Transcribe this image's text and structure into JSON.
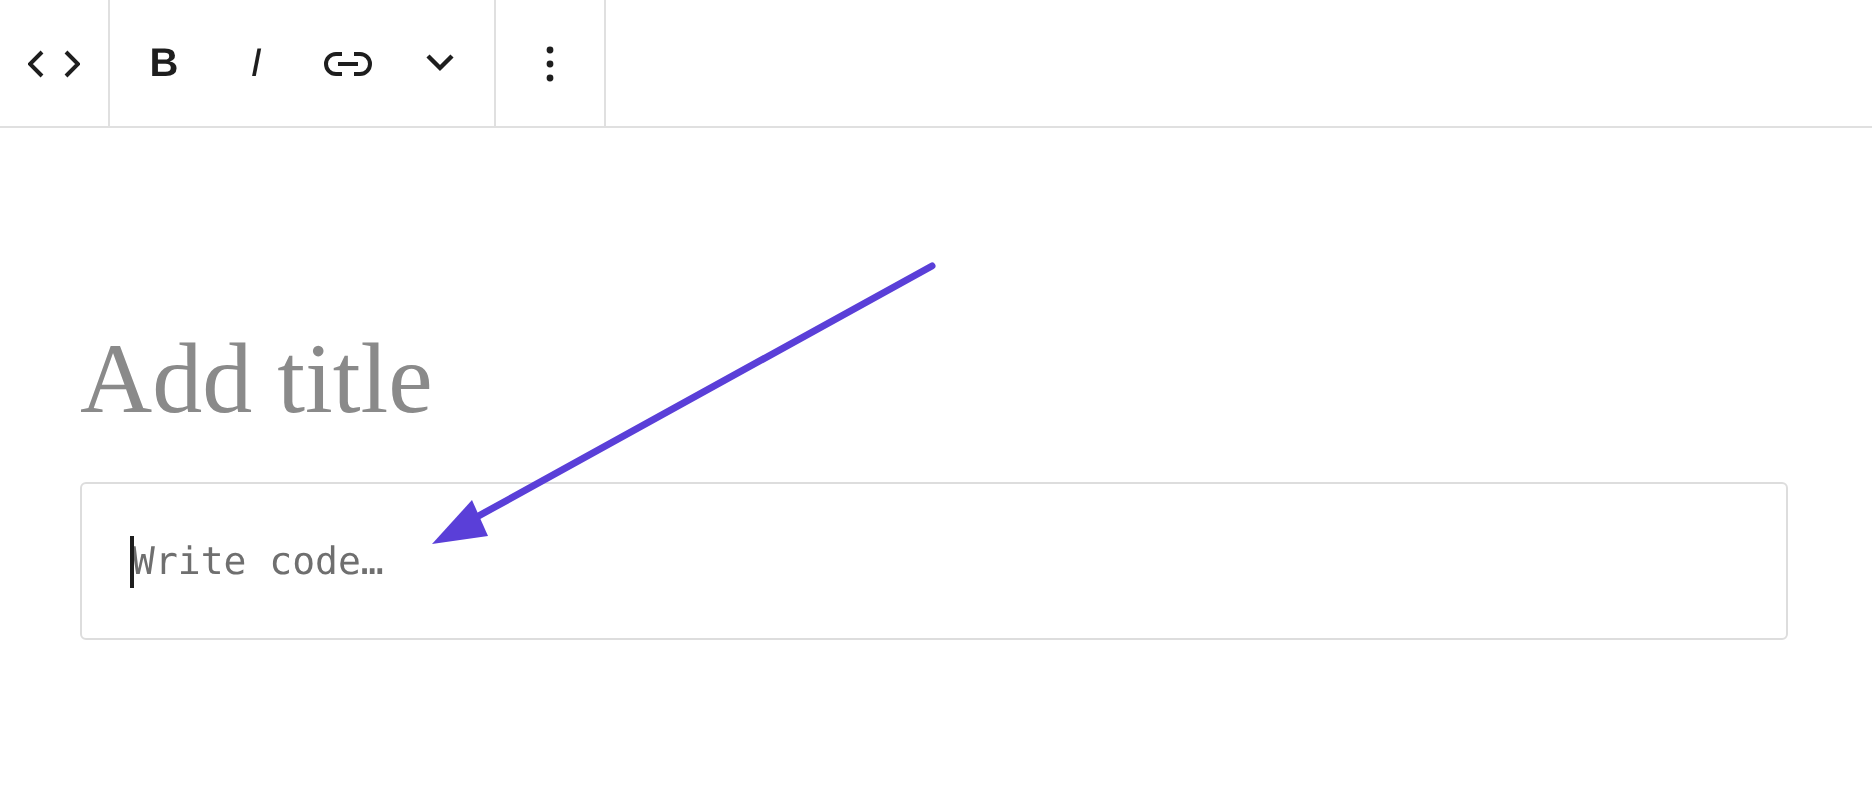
{
  "toolbar": {
    "groups": [
      {
        "buttons": [
          {
            "kind": "code"
          }
        ]
      },
      {
        "buttons": [
          {
            "kind": "bold",
            "label": "B"
          },
          {
            "kind": "italic",
            "label": "I"
          },
          {
            "kind": "link"
          },
          {
            "kind": "chevron"
          }
        ]
      },
      {
        "buttons": [
          {
            "kind": "more"
          }
        ]
      }
    ]
  },
  "title": {
    "placeholder": "Add title"
  },
  "code_block": {
    "placeholder": "Write code…"
  }
}
